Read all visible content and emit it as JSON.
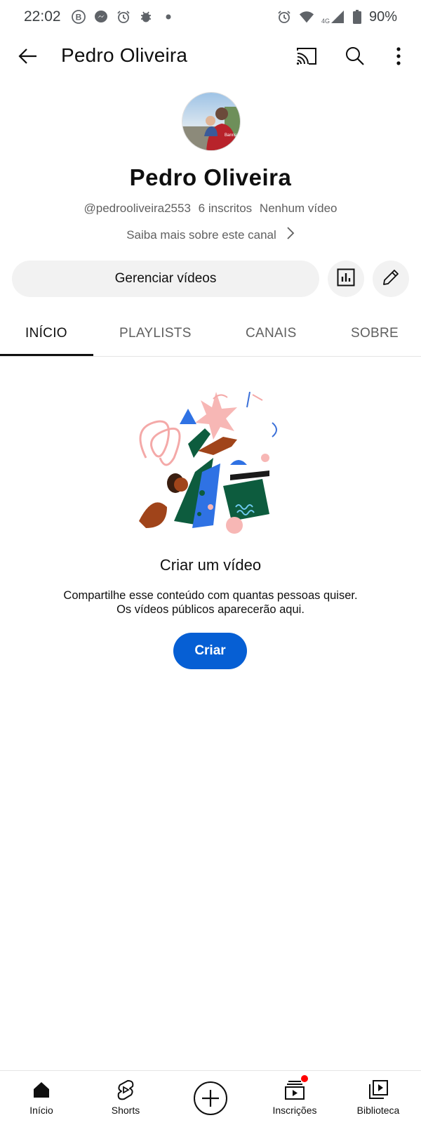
{
  "status_bar": {
    "time": "22:02",
    "battery": "90%",
    "left_icons": [
      "b-app-icon",
      "messenger-icon",
      "alarm-icon",
      "bug-icon",
      "dot-icon"
    ],
    "right_icons": [
      "alarm-icon",
      "wifi-icon",
      "signal-4g-icon",
      "battery-icon"
    ]
  },
  "app_bar": {
    "title": "Pedro Oliveira",
    "icons": [
      "back-arrow-icon",
      "cast-icon",
      "search-icon",
      "more-vert-icon"
    ]
  },
  "channel": {
    "name": "Pedro Oliveira",
    "handle": "@pedrooliveira2553",
    "subscribers": "6 inscritos",
    "videos": "Nenhum vídeo",
    "about_link": "Saiba mais sobre este canal"
  },
  "actions": {
    "manage_videos": "Gerenciar vídeos",
    "icons": [
      "analytics-icon",
      "edit-pencil-icon"
    ]
  },
  "tabs": [
    {
      "label": "INÍCIO",
      "active": true
    },
    {
      "label": "PLAYLISTS",
      "active": false
    },
    {
      "label": "CANAIS",
      "active": false
    },
    {
      "label": "SOBRE",
      "active": false
    }
  ],
  "empty_state": {
    "title": "Criar um vídeo",
    "description_line1": "Compartilhe esse conteúdo com quantas pessoas quiser.",
    "description_line2": "Os vídeos públicos aparecerão aqui.",
    "button": "Criar"
  },
  "bottom_nav": [
    {
      "label": "Início",
      "icon": "home-icon",
      "active": true
    },
    {
      "label": "Shorts",
      "icon": "shorts-icon",
      "active": false
    },
    {
      "label": "",
      "icon": "create-plus-icon",
      "active": false
    },
    {
      "label": "Inscrições",
      "icon": "subscriptions-icon",
      "active": false,
      "badge": true
    },
    {
      "label": "Biblioteca",
      "icon": "library-icon",
      "active": false
    }
  ],
  "colors": {
    "accent_blue": "#065fd4",
    "text_primary": "#0f0f0f",
    "text_secondary": "#606060",
    "chip_bg": "#f2f2f2",
    "badge_red": "#ff0000"
  }
}
